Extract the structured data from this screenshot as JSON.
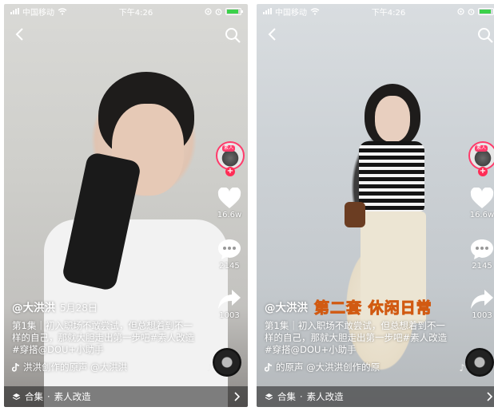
{
  "status_bar": {
    "carrier": "中国移动",
    "time": "下午4:26"
  },
  "screens": [
    {
      "likes": "16.6w",
      "comments": "2145",
      "shares": "1003",
      "username": "@大洪洪",
      "date": "5月28日",
      "description": "第1集｜初入职场不敢尝试，但总想着到不一样的自己，那就大胆走出第一步吧#素人改造 #穿搭@DOU+小助手",
      "music": "洪洪创作的原声   @大洪洪",
      "collection_label": "合集",
      "collection_name": "素人改造"
    },
    {
      "likes": "16.6w",
      "comments": "2145",
      "shares": "1003",
      "username": "@大洪洪",
      "date": "",
      "overlay_title": "第二套  休闲日常",
      "description": "第1集｜初入职场不敢尝试，但总想着到不一样的自己，那就大胆走出第一步吧#素人改造 #穿搭@DOU+小助手",
      "music": "的原声   @大洪洪创作的原",
      "collection_label": "合集",
      "collection_name": "素人改造"
    }
  ],
  "avatar_tag": "素人",
  "colors": {
    "accent": "#ff2c55",
    "battery": "#3bd14a",
    "overlay_text": "#ffdd44"
  },
  "icons": [
    "back-icon",
    "search-icon",
    "heart-icon",
    "comment-icon",
    "share-icon",
    "music-disc-icon",
    "tiktok-note-icon",
    "collection-icon",
    "chevron-right-icon",
    "wifi-icon",
    "battery-icon",
    "alarm-icon",
    "location-icon"
  ]
}
